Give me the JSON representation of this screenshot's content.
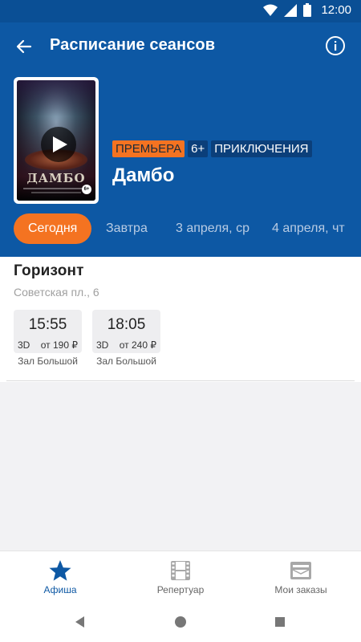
{
  "status_bar": {
    "time": "12:00"
  },
  "app_bar": {
    "title": "Расписание сеансов"
  },
  "movie": {
    "poster": {
      "title_art": "ДАМБО",
      "age_mark": "6+"
    },
    "tags": {
      "premiere": "ПРЕМЬЕРА",
      "age": "6+",
      "genre": "ПРИКЛЮЧЕНИЯ"
    },
    "title": "Дамбо"
  },
  "dates": [
    {
      "label": "Сегодня",
      "active": true
    },
    {
      "label": "Завтра"
    },
    {
      "label": "3 апреля, ср"
    },
    {
      "label": "4 апреля, чт"
    }
  ],
  "cinema": {
    "name": "Горизонт",
    "address": "Советская пл., 6",
    "sessions": [
      {
        "time": "15:55",
        "format": "3D",
        "price": "от 190 ₽",
        "hall": "Зал Большой"
      },
      {
        "time": "18:05",
        "format": "3D",
        "price": "от 240 ₽",
        "hall": "Зал Большой"
      }
    ]
  },
  "bottom_nav": [
    {
      "label": "Афиша",
      "icon": "star-icon",
      "active": true
    },
    {
      "label": "Репертуар",
      "icon": "film-icon"
    },
    {
      "label": "Мои заказы",
      "icon": "tickets-icon"
    }
  ],
  "colors": {
    "primary": "#0d58a4",
    "accent": "#f47321",
    "tag_dark": "#0b3f7a"
  }
}
